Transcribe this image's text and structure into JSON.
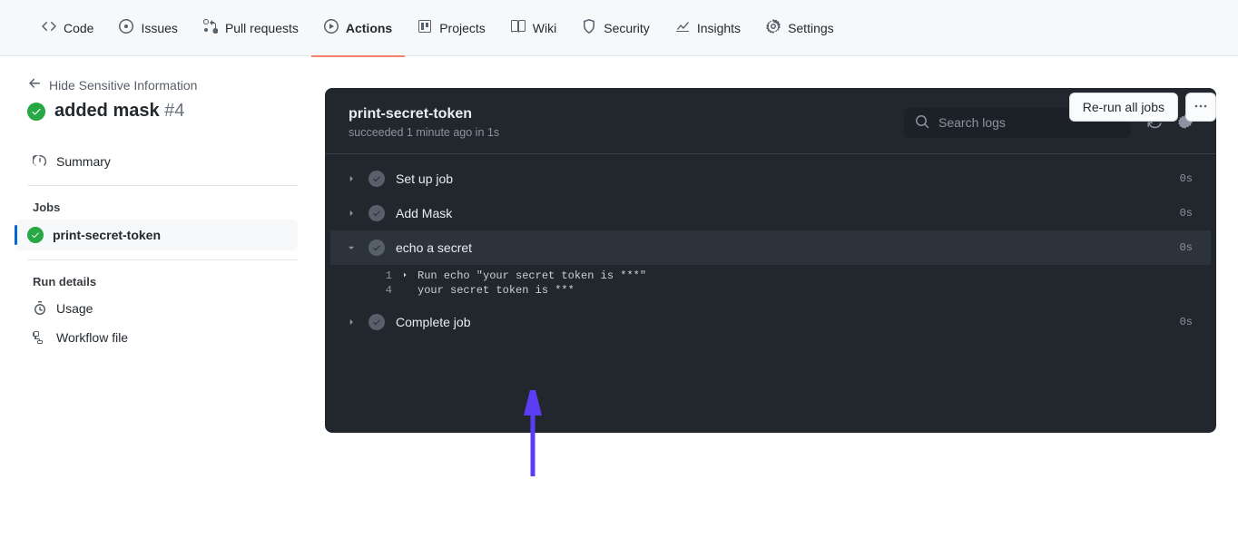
{
  "nav": {
    "code": "Code",
    "issues": "Issues",
    "pull_requests": "Pull requests",
    "actions": "Actions",
    "projects": "Projects",
    "wiki": "Wiki",
    "security": "Security",
    "insights": "Insights",
    "settings": "Settings"
  },
  "breadcrumb": {
    "back_label": "Hide Sensitive Information"
  },
  "run": {
    "title": "added mask",
    "number": "#4",
    "rerun_label": "Re-run all jobs"
  },
  "sidebar": {
    "summary_label": "Summary",
    "jobs_label": "Jobs",
    "job_name": "print-secret-token",
    "run_details_label": "Run details",
    "usage_label": "Usage",
    "workflow_file_label": "Workflow file"
  },
  "panel": {
    "title": "print-secret-token",
    "subtitle": "succeeded 1 minute ago in 1s",
    "search_placeholder": "Search logs"
  },
  "steps": [
    {
      "name": "Set up job",
      "duration": "0s",
      "expanded": false
    },
    {
      "name": "Add Mask",
      "duration": "0s",
      "expanded": false
    },
    {
      "name": "echo a secret",
      "duration": "0s",
      "expanded": true
    },
    {
      "name": "Complete job",
      "duration": "0s",
      "expanded": false
    }
  ],
  "log": {
    "line1_no": "1",
    "line1_text": "Run echo \"your secret token is ***\"",
    "line2_no": "4",
    "line2_text": "your secret token is ***"
  }
}
